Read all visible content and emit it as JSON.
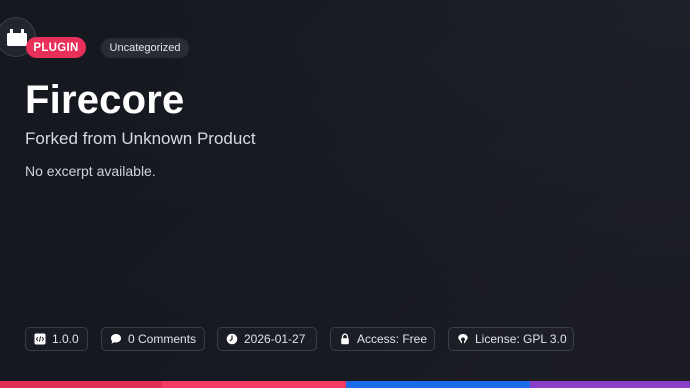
{
  "header": {
    "plugin_icon": "plugin-block-icon",
    "type_badge": "PLUGIN",
    "category_badge": "Uncategorized"
  },
  "content": {
    "title": "Firecore",
    "subtitle": "Forked from Unknown Product",
    "excerpt": "No excerpt available."
  },
  "meta": {
    "version": "1.0.0",
    "comments": "0 Comments",
    "date": "2026-01-27",
    "access": "Access: Free",
    "license": "License: GPL 3.0"
  },
  "icons": {
    "version": "code-icon",
    "comments": "comment-bubble-icon",
    "date": "clock-icon",
    "access": "lock-icon",
    "license": "open-source-icon"
  },
  "colors": {
    "accent": "#e8305a",
    "background": "#15171e",
    "bar_segments": [
      "#e02e55",
      "#f23a62",
      "#1a6be6",
      "#8a3fc9"
    ]
  }
}
